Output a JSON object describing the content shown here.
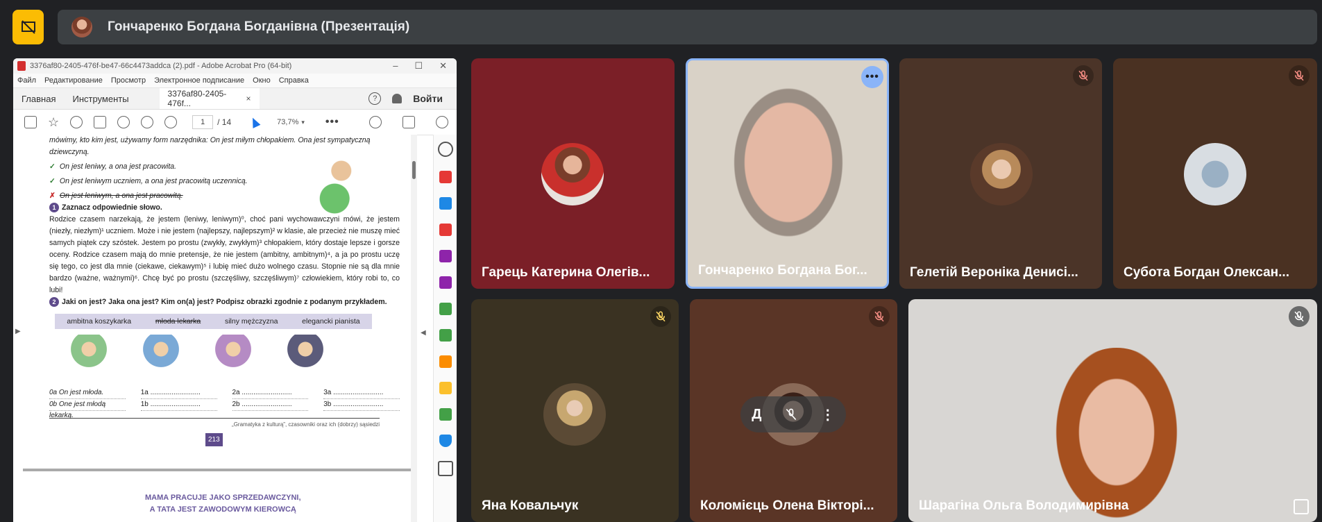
{
  "presentation": {
    "title": "Гончаренко Богдана Богданівна (Презентація)"
  },
  "acrobat": {
    "window_title": "3376af80-2405-476f-be47-66c4473addca (2).pdf - Adobe Acrobat Pro (64-bit)",
    "menu": [
      "Файл",
      "Редактирование",
      "Просмотр",
      "Электронное подписание",
      "Окно",
      "Справка"
    ],
    "tabs": {
      "home": "Главная",
      "tools": "Инструменты",
      "document": "3376af80-2405-476f...",
      "close": "×"
    },
    "login": "Войти",
    "help": "?",
    "page_current": "1",
    "page_total": "/ 14",
    "zoom": "73,7%",
    "more": "•••"
  },
  "document": {
    "intro": "mówimy, kto kim jest, używamy form narzędnika: On jest miłym chłopakiem. Ona jest sympatyczną dziewczyną.",
    "examples": [
      {
        "mark": "✓",
        "text": "On jest leniwy, a ona jest pracowita."
      },
      {
        "mark": "✓",
        "text": "On jest leniwym uczniem, a ona jest pracowitą uczennicą."
      },
      {
        "mark": "✗",
        "text": "On jest leniwym, a ona jest pracowitą."
      }
    ],
    "task1": {
      "num": "1",
      "title": "Zaznacz odpowiednie słowo."
    },
    "task1_text": "Rodzice czasem narzekają, że jestem (leniwy, leniwym)⁰, choć pani wychowawczyni mówi, że jestem (niezły, niezłym)¹ uczniem. Może i nie jestem (najlepszy, najlepszym)² w klasie, ale przecież nie muszę mieć samych piątek czy szóstek. Jestem po prostu (zwykły, zwykłym)³ chłopakiem, który dostaje lepsze i gorsze oceny. Rodzice czasem mają do mnie pretensje, że nie jestem (ambitny, ambitnym)⁴, a ja po prostu uczę się tego, co jest dla mnie (ciekawe, ciekawym)⁵ i lubię mieć dużo wolnego czasu. Stopnie nie są dla mnie bardzo (ważne, ważnymi)⁶. Chcę być po prostu (szczęśliwy, szczęśliwym)⁷ człowiekiem, który robi to, co lubi!",
    "task2": {
      "num": "2",
      "title": "Jaki on jest? Jaka ona jest? Kim on(a) jest? Podpisz obrazki zgodnie z podanym przykładem."
    },
    "word_box": [
      "ambitna koszykarka",
      "młoda lekarka",
      "silny mężczyzna",
      "elegancki pianista"
    ],
    "answers": [
      [
        "0a  On jest młoda.",
        "0b  One jest młodą lekarką."
      ],
      [
        "1a ..........................",
        "1b .........................."
      ],
      [
        "2a ..........................",
        "2b .........................."
      ],
      [
        "3a ..........................",
        "3b .........................."
      ]
    ],
    "footer": "„Gramatyka z kulturą”, czasowniki oraz ich (dobrzy) sąsiedzi",
    "page_number": "213",
    "next_title_1": "MAMA PRACUJE JAKO SPRZEDAWCZYNI,",
    "next_title_2": "A TATA JEST ZAWODOWYM KIEROWCĄ"
  },
  "participants": [
    {
      "name": "Гарець Катерина Олегів...",
      "muted": false,
      "bg": "#7b1f27"
    },
    {
      "name": "Гончаренко Богдана Бог...",
      "muted": false,
      "bg": "#d9d2c7",
      "active": true
    },
    {
      "name": "Гелетій Вероніка Денисі...",
      "muted": true,
      "bg": "#4b3428"
    },
    {
      "name": "Субота Богдан Олексан...",
      "muted": true,
      "bg": "#4a3122"
    },
    {
      "name": "Яна Ковальчук",
      "muted": true,
      "bg": "#3a3222"
    },
    {
      "name": "Коломієць Олена Вікторі...",
      "muted": true,
      "bg": "#5a3526"
    },
    {
      "name": "Шарагіна Ольга Володимирівна",
      "muted": true,
      "bg": "#d8d6d3"
    }
  ],
  "overlay_letter": "Д",
  "colors": {
    "accent": "#fbbc04",
    "active_border": "#8ab4f8"
  }
}
